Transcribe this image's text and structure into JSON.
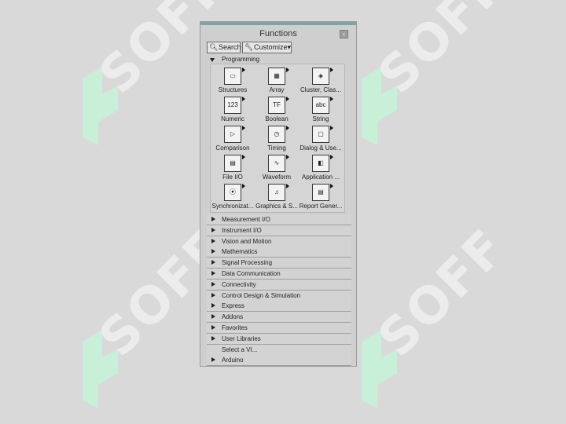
{
  "panel": {
    "title": "Functions",
    "pin_icon": "pin-icon"
  },
  "toolbar": {
    "search_label": "Search",
    "customize_label": "Customize▾"
  },
  "programming": {
    "label": "Programming",
    "items": [
      {
        "label": "Structures",
        "icon": "structures-icon"
      },
      {
        "label": "Array",
        "icon": "array-icon"
      },
      {
        "label": "Cluster, Clas...",
        "icon": "cluster-class-icon"
      },
      {
        "label": "Numeric",
        "icon": "numeric-icon"
      },
      {
        "label": "Boolean",
        "icon": "boolean-icon"
      },
      {
        "label": "String",
        "icon": "string-icon"
      },
      {
        "label": "Comparison",
        "icon": "comparison-icon"
      },
      {
        "label": "Timing",
        "icon": "timing-icon"
      },
      {
        "label": "Dialog & Use...",
        "icon": "dialog-user-interface-icon"
      },
      {
        "label": "File I/O",
        "icon": "file-io-icon"
      },
      {
        "label": "Waveform",
        "icon": "waveform-icon"
      },
      {
        "label": "Application ...",
        "icon": "application-control-icon"
      },
      {
        "label": "Synchronizat...",
        "icon": "synchronization-icon"
      },
      {
        "label": "Graphics & S...",
        "icon": "graphics-sound-icon"
      },
      {
        "label": "Report Gener...",
        "icon": "report-generation-icon"
      }
    ]
  },
  "categories": [
    {
      "label": "Measurement I/O",
      "expandable": true
    },
    {
      "label": "Instrument I/O",
      "expandable": true
    },
    {
      "label": "Vision and Motion",
      "expandable": true
    },
    {
      "label": "Mathematics",
      "expandable": true
    },
    {
      "label": "Signal Processing",
      "expandable": true
    },
    {
      "label": "Data Communication",
      "expandable": true
    },
    {
      "label": "Connectivity",
      "expandable": true
    },
    {
      "label": "Control Design & Simulation",
      "expandable": true
    },
    {
      "label": "Express",
      "expandable": true
    },
    {
      "label": "Addons",
      "expandable": true
    },
    {
      "label": "Favorites",
      "expandable": true
    },
    {
      "label": "User Libraries",
      "expandable": true
    },
    {
      "label": "Select a VI...",
      "expandable": false
    },
    {
      "label": "Arduino",
      "expandable": true
    }
  ],
  "watermark": {
    "text": "SOFF",
    "color": "#c8f0d8"
  }
}
